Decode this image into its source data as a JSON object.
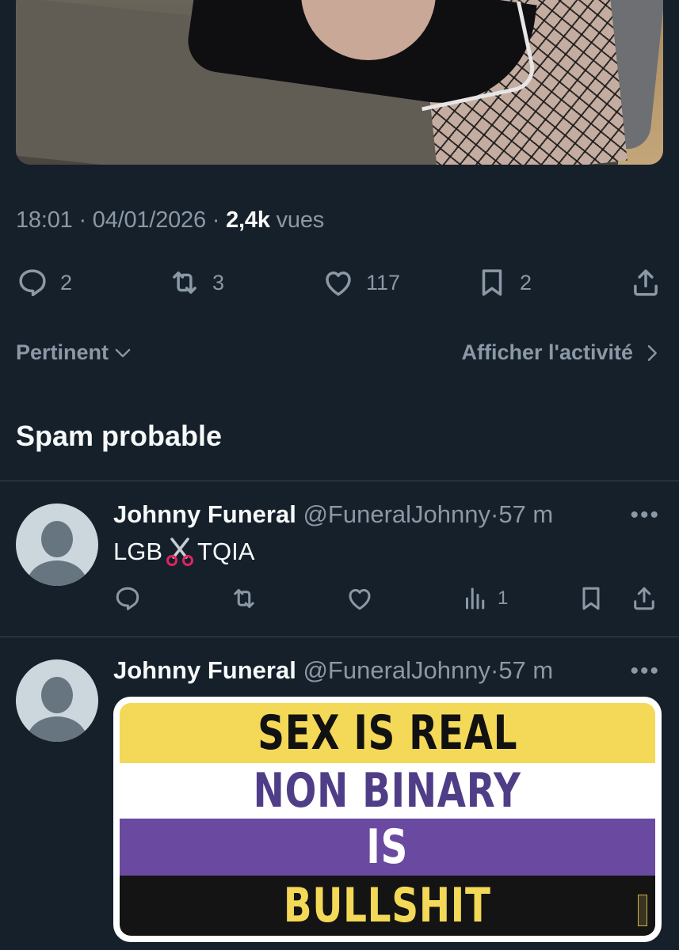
{
  "tweet": {
    "time": "18:01",
    "date": "04/01/2026",
    "views_count": "2,4k",
    "views_label": "vues",
    "separator": "·",
    "stats": {
      "replies": "2",
      "retweets": "3",
      "likes": "117",
      "bookmarks": "2"
    }
  },
  "sort": {
    "label": "Pertinent",
    "activity_label": "Afficher l'activité"
  },
  "section_title": "Spam probable",
  "replies": [
    {
      "name": "Johnny Funeral",
      "handle": "@FuneralJohnny",
      "time": "57 m",
      "separator": "·",
      "text_before": "LGB",
      "text_after": "TQIA",
      "views": "1"
    },
    {
      "name": "Johnny Funeral",
      "handle": "@FuneralJohnny",
      "time": "57 m",
      "separator": "·",
      "sticker_lines": [
        "SEX IS REAL",
        "NON BINARY",
        "IS",
        "BULLSHIT"
      ]
    }
  ],
  "colors": {
    "background": "#15202b",
    "muted": "#8b98a5",
    "text": "#f7f9f9",
    "divider": "#38444d",
    "flag_yellow": "#f3d957",
    "flag_purple": "#6a4aa0",
    "flag_black": "#141414",
    "flag_white": "#ffffff"
  },
  "icons": [
    "reply-icon",
    "retweet-icon",
    "like-icon",
    "bookmark-icon",
    "share-icon",
    "views-icon",
    "chevron-down-icon",
    "chevron-right-icon",
    "scissors-icon",
    "more-icon"
  ]
}
